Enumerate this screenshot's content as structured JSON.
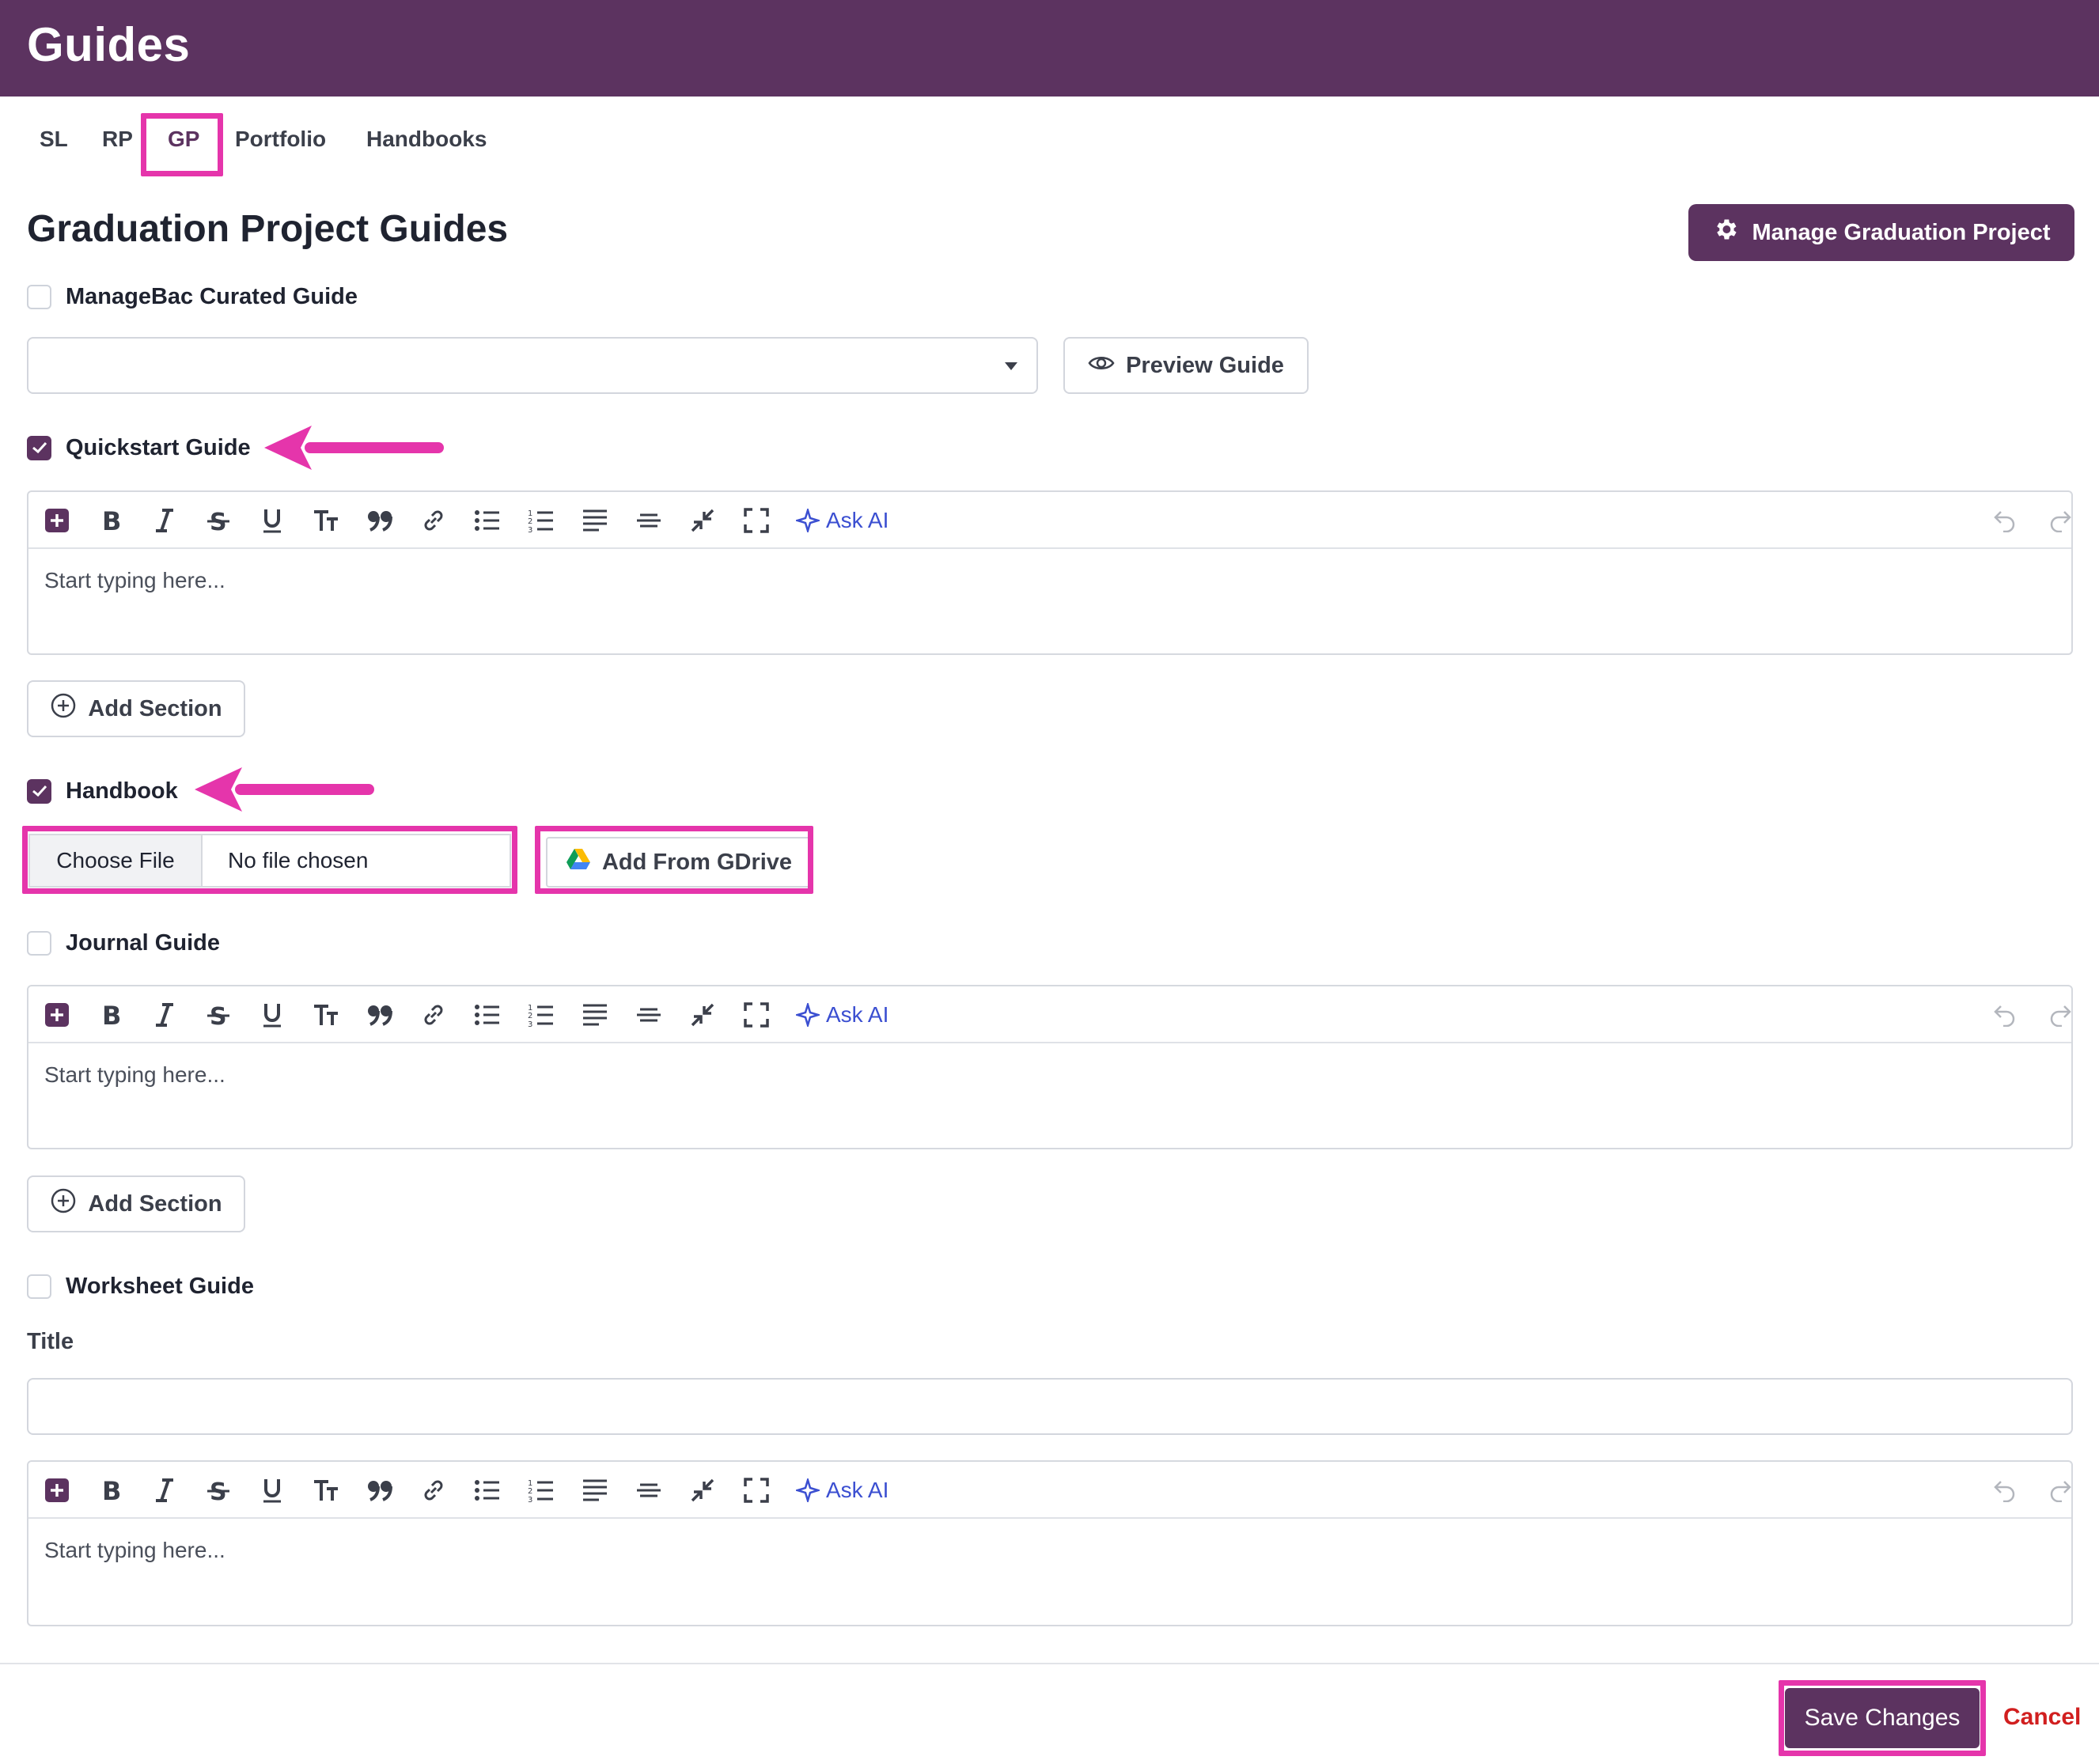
{
  "header": {
    "title": "Guides"
  },
  "tabs": [
    {
      "label": "SL",
      "active": false
    },
    {
      "label": "RP",
      "active": false
    },
    {
      "label": "GP",
      "active": true
    },
    {
      "label": "Portfolio",
      "active": false
    },
    {
      "label": "Handbooks",
      "active": false
    }
  ],
  "page": {
    "title": "Graduation Project Guides",
    "manage_button": "Manage Graduation Project"
  },
  "curated_guide": {
    "label": "ManageBac Curated Guide",
    "checked": false,
    "select_value": "",
    "preview_button": "Preview Guide"
  },
  "quickstart_guide": {
    "label": "Quickstart Guide",
    "checked": true,
    "editor_placeholder": "Start typing here...",
    "add_section": "Add Section"
  },
  "handbook": {
    "label": "Handbook",
    "checked": true,
    "choose_file": "Choose File",
    "file_status": "No file chosen",
    "gdrive_button": "Add From GDrive"
  },
  "journal_guide": {
    "label": "Journal Guide",
    "checked": false,
    "editor_placeholder": "Start typing here...",
    "add_section": "Add Section"
  },
  "worksheet_guide": {
    "label": "Worksheet Guide",
    "checked": false,
    "title_label": "Title",
    "title_value": "",
    "editor_placeholder": "Start typing here..."
  },
  "editor_toolbar": {
    "ask_ai": "Ask AI",
    "icons": [
      "add-block-icon",
      "bold-icon",
      "italic-icon",
      "strikethrough-icon",
      "underline-icon",
      "text-size-icon",
      "quote-icon",
      "link-icon",
      "bulleted-list-icon",
      "numbered-list-icon",
      "align-icon",
      "horizontal-rule-icon",
      "collapse-icon",
      "fullscreen-icon",
      "sparkle-icon",
      "undo-icon",
      "redo-icon"
    ]
  },
  "footer": {
    "save_button": "Save Changes",
    "cancel_link": "Cancel"
  },
  "colors": {
    "brand": "#5c3360",
    "highlight": "#e535ab",
    "ask_ai": "#3b4fd1",
    "cancel": "#d11f1f"
  }
}
